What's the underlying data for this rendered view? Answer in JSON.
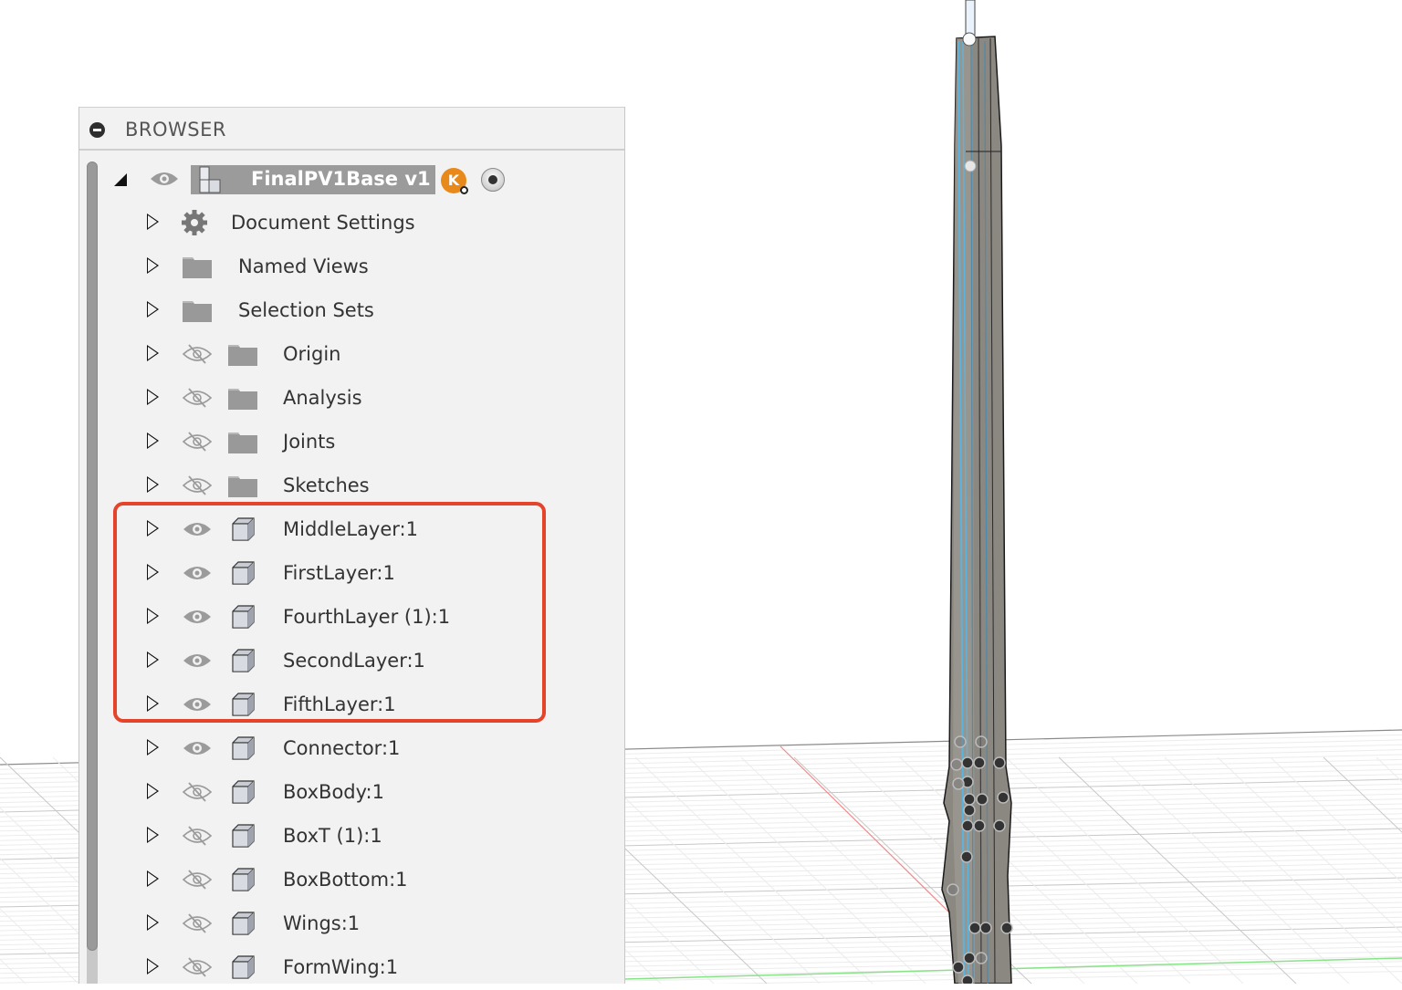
{
  "browser": {
    "title": "BROWSER",
    "root": {
      "label": "FinalPV1Base v1",
      "user_badge": "K",
      "visible": true
    },
    "items": [
      {
        "label": "Document Settings",
        "icon": "gear-icon",
        "visibility": "none"
      },
      {
        "label": "Named Views",
        "icon": "folder-icon",
        "visibility": "none"
      },
      {
        "label": "Selection Sets",
        "icon": "folder-icon",
        "visibility": "none"
      },
      {
        "label": "Origin",
        "icon": "folder-icon",
        "visibility": "hidden"
      },
      {
        "label": "Analysis",
        "icon": "folder-icon",
        "visibility": "hidden"
      },
      {
        "label": "Joints",
        "icon": "folder-icon",
        "visibility": "hidden"
      },
      {
        "label": "Sketches",
        "icon": "folder-icon",
        "visibility": "hidden"
      },
      {
        "label": "MiddleLayer:1",
        "icon": "component-icon",
        "visibility": "visible"
      },
      {
        "label": "FirstLayer:1",
        "icon": "component-icon",
        "visibility": "visible"
      },
      {
        "label": "FourthLayer (1):1",
        "icon": "component-icon",
        "visibility": "visible"
      },
      {
        "label": "SecondLayer:1",
        "icon": "component-icon",
        "visibility": "visible"
      },
      {
        "label": "FifthLayer:1",
        "icon": "component-icon",
        "visibility": "visible"
      },
      {
        "label": "Connector:1",
        "icon": "component-icon",
        "visibility": "visible"
      },
      {
        "label": "BoxBody:1",
        "icon": "component-icon",
        "visibility": "hidden"
      },
      {
        "label": "BoxT (1):1",
        "icon": "component-icon",
        "visibility": "hidden"
      },
      {
        "label": "BoxBottom:1",
        "icon": "component-icon",
        "visibility": "hidden"
      },
      {
        "label": "Wings:1",
        "icon": "component-icon",
        "visibility": "hidden"
      },
      {
        "label": "FormWing:1",
        "icon": "component-icon",
        "visibility": "hidden"
      }
    ],
    "highlight_color": "#e5432a"
  },
  "colors": {
    "accent_edge": "#5ab4e0",
    "body_fill": "#8a8680",
    "x_axis": "#f08080",
    "y_axis": "#7ee07e"
  }
}
